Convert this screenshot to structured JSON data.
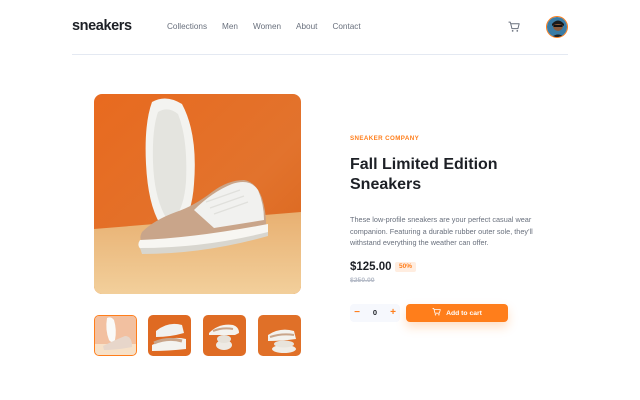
{
  "header": {
    "logo": "sneakers",
    "nav": [
      "Collections",
      "Men",
      "Women",
      "About",
      "Contact"
    ]
  },
  "icons": {
    "cart": "cart-icon",
    "avatar": "user-avatar"
  },
  "product": {
    "company": "SNEAKER COMPANY",
    "title": "Fall Limited Edition Sneakers",
    "description": "These low-profile sneakers are your perfect casual wear companion. Featuring a durable rubber outer sole, they'll withstand everything the weather can offer.",
    "price": "$125.00",
    "discount": "50%",
    "old_price": "$250.00",
    "quantity": "0",
    "minus_label": "−",
    "plus_label": "+",
    "add_to_cart": "Add to cart",
    "thumbnails": 4,
    "selected_thumbnail": 1
  },
  "colors": {
    "accent": "#ff7e1b",
    "accent_pale": "#ffede0",
    "text_dark": "#1d2026",
    "text_gray": "#69707d"
  }
}
